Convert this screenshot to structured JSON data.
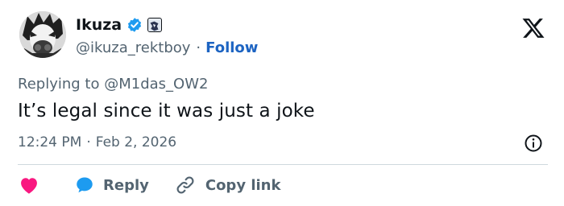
{
  "author": {
    "name": "Ikuza",
    "handle": "@ikuza_rektboy",
    "separator": "·",
    "follow_label": "Follow"
  },
  "platform": {
    "logo_icon": "x-logo-icon"
  },
  "tweet": {
    "replying_prefix": "Replying to",
    "replying_to": "@M1das_OW2",
    "text": "It’s legal since it was just a joke",
    "time": "12:24 PM",
    "meta_separator": "·",
    "date": "Feb 2, 2026"
  },
  "actions": {
    "like_icon": "heart-icon",
    "reply_icon": "speech-bubble-icon",
    "reply_label": "Reply",
    "copy_icon": "link-icon",
    "copy_label": "Copy link"
  },
  "colors": {
    "follow_blue": "#1d64c2",
    "verified_blue": "#1d9bf0",
    "heart_pink": "#f91880",
    "secondary_text": "#536471"
  }
}
